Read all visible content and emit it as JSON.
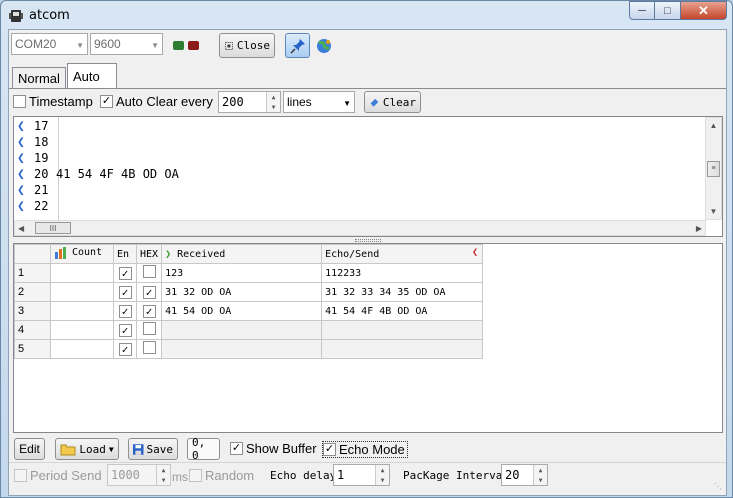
{
  "window": {
    "title": "atcom",
    "min_icon": "minimize-icon",
    "max_icon": "maximize-icon",
    "close_icon": "close-icon"
  },
  "toolbar": {
    "port": "COM20",
    "baud": "9600",
    "close_label": "Close",
    "led_colors": [
      "#2e7d32",
      "#8b1a1a"
    ]
  },
  "tabs": [
    {
      "label": "Normal"
    },
    {
      "label": "Auto"
    }
  ],
  "options": {
    "timestamp_label": "Timestamp",
    "timestamp_checked": false,
    "auto_clear_label": "Auto Clear every",
    "auto_clear_checked": true,
    "auto_clear_value": "200",
    "unit": "lines",
    "clear_label": "Clear"
  },
  "log": {
    "lines": [
      {
        "num": "17",
        "text": ""
      },
      {
        "num": "18",
        "text": ""
      },
      {
        "num": "19",
        "text": ""
      },
      {
        "num": "20",
        "text": "41 54 4F 4B OD OA"
      },
      {
        "num": "21",
        "text": ""
      },
      {
        "num": "22",
        "text": ""
      }
    ],
    "hscroll_grip": "III"
  },
  "grid": {
    "headers": {
      "count": "Count",
      "en": "En",
      "hex": "HEX",
      "received": "Received",
      "echo": "Echo/Send"
    },
    "rows": [
      {
        "num": "1",
        "en": true,
        "hex": false,
        "received": "123",
        "echo": "112233"
      },
      {
        "num": "2",
        "en": true,
        "hex": true,
        "received": "31 32 OD OA",
        "echo": "31 32 33 34 35 OD OA"
      },
      {
        "num": "3",
        "en": true,
        "hex": true,
        "received": "41 54 OD OA",
        "echo": "41 54 4F 4B OD OA"
      },
      {
        "num": "4",
        "en": true,
        "hex": false,
        "received": "",
        "echo": ""
      },
      {
        "num": "5",
        "en": true,
        "hex": false,
        "received": "",
        "echo": ""
      }
    ]
  },
  "bottom": {
    "edit_label": "Edit",
    "load_label": "Load",
    "save_label": "Save",
    "coords": "0, 0",
    "show_buffer_label": "Show Buffer",
    "show_buffer_checked": true,
    "echo_mode_label": "Echo Mode",
    "echo_mode_checked": true
  },
  "status": {
    "period_send_label": "Period Send",
    "period_value": "1000",
    "ms_label": "ms",
    "random_label": "Random",
    "echo_delay_label": "Echo delay",
    "echo_delay_value": "1",
    "package_interval_label": "PacKage Interval",
    "package_interval_value": "20"
  }
}
